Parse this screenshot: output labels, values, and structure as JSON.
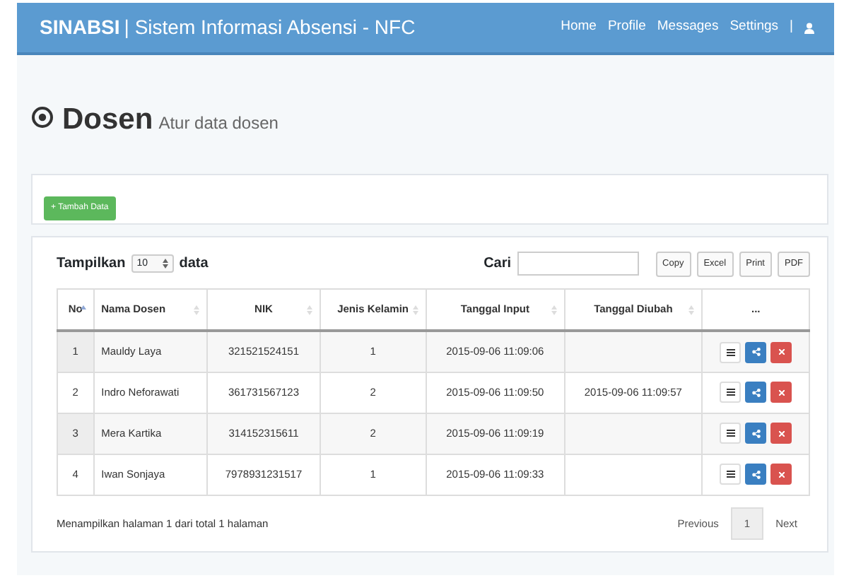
{
  "navbar": {
    "brand": "SINABSI",
    "subtitle": "| Sistem Informasi Absensi - NFC",
    "links": [
      "Home",
      "Profile",
      "Messages",
      "Settings"
    ],
    "separator": "|"
  },
  "header": {
    "title": "Dosen",
    "subtitle": "Atur data dosen"
  },
  "add_button": "+ Tambah Data",
  "table_controls": {
    "show_label": "Tampilkan",
    "page_size": "10",
    "show_suffix": "data",
    "search_label": "Cari",
    "export_buttons": [
      "Copy",
      "Excel",
      "Print",
      "PDF"
    ]
  },
  "table": {
    "columns": [
      {
        "label": "No",
        "sorted": true
      },
      {
        "label": "Nama Dosen",
        "sorted": false
      },
      {
        "label": "NIK",
        "sorted": false
      },
      {
        "label": "Jenis Kelamin",
        "sorted": false
      },
      {
        "label": "Tanggal Input",
        "sorted": false
      },
      {
        "label": "Tanggal Diubah",
        "sorted": false
      },
      {
        "label": "..."
      }
    ],
    "rows": [
      {
        "cells": [
          "1",
          "Mauldy Laya",
          "321521524151",
          "1",
          "2015-09-06 11:09:06",
          ""
        ]
      },
      {
        "cells": [
          "2",
          "Indro Neforawati",
          "361731567123",
          "2",
          "2015-09-06 11:09:50",
          "2015-09-06 11:09:57"
        ]
      },
      {
        "cells": [
          "3",
          "Mera Kartika",
          "314152315611",
          "2",
          "2015-09-06 11:09:19",
          ""
        ]
      },
      {
        "cells": [
          "4",
          "Iwan Sonjaya",
          "7978931231517",
          "1",
          "2015-09-06 11:09:33",
          ""
        ]
      }
    ]
  },
  "footer": {
    "info": "Menampilkan halaman 1 dari total 1 halaman",
    "pages": [
      {
        "label": "Previous",
        "selected": false
      },
      {
        "label": "1",
        "selected": true
      },
      {
        "label": "Next",
        "selected": false
      }
    ]
  }
}
